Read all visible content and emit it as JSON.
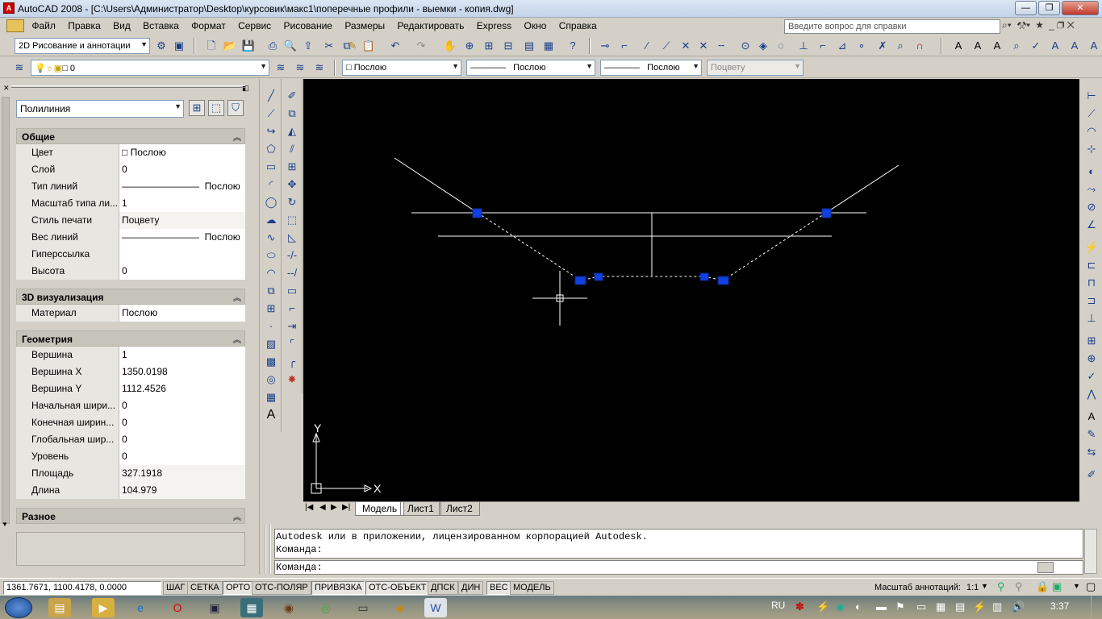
{
  "window": {
    "title": "AutoCAD 2008 - [C:\\Users\\Администратор\\Desktop\\курсовик\\макс1\\поперечные профили - выемки - копия.dwg]",
    "help_placeholder": "Введите вопрос для справки"
  },
  "menu": [
    "Файл",
    "Правка",
    "Вид",
    "Вставка",
    "Формат",
    "Сервис",
    "Рисование",
    "Размеры",
    "Редактировать",
    "Express",
    "Окно",
    "Справка"
  ],
  "toolbar": {
    "workspace": "2D Рисование и аннотации",
    "layer": "0",
    "color": "Послою",
    "linetype": "Послою",
    "lineweight": "Послою",
    "plotstyle": "Поцвету"
  },
  "palette": {
    "object_type": "Полилиния",
    "sections": {
      "general": {
        "title": "Общие",
        "rows": [
          {
            "name": "Цвет",
            "value": "Послою"
          },
          {
            "name": "Слой",
            "value": "0"
          },
          {
            "name": "Тип линий",
            "value": "Послою"
          },
          {
            "name": "Масштаб типа ли...",
            "value": "1"
          },
          {
            "name": "Стиль печати",
            "value": "Поцвету"
          },
          {
            "name": "Вес линий",
            "value": "Послою"
          },
          {
            "name": "Гиперссылка",
            "value": ""
          },
          {
            "name": "Высота",
            "value": "0"
          }
        ]
      },
      "visual3d": {
        "title": "3D визуализация",
        "rows": [
          {
            "name": "Материал",
            "value": "Послою"
          }
        ]
      },
      "geometry": {
        "title": "Геометрия",
        "rows": [
          {
            "name": "Вершина",
            "value": "1"
          },
          {
            "name": "Вершина X",
            "value": "1350.0198"
          },
          {
            "name": "Вершина Y",
            "value": "1112.4526"
          },
          {
            "name": "Начальная шири...",
            "value": "0"
          },
          {
            "name": "Конечная ширин...",
            "value": "0"
          },
          {
            "name": "Глобальная шир...",
            "value": "0"
          },
          {
            "name": "Уровень",
            "value": "0"
          },
          {
            "name": "Площадь",
            "value": "327.1918"
          },
          {
            "name": "Длина",
            "value": "104.979"
          }
        ]
      },
      "misc": {
        "title": "Разное"
      }
    }
  },
  "drawing": {
    "ucs_x": "X",
    "ucs_y": "Y",
    "tabs": [
      "Модель",
      "Лист1",
      "Лист2"
    ]
  },
  "command": {
    "history": [
      "Autodesk или в приложении, лицензированном корпорацией Autodesk.",
      "Команда:"
    ],
    "prompt": "Команда:"
  },
  "status": {
    "coords": "1361.7671, 1100.4178, 0.0000",
    "buttons": [
      "ШАГ",
      "СЕТКА",
      "ОРТО",
      "ОТС-ПОЛЯР",
      "ПРИВЯЗКА",
      "ОТС-ОБЪЕКТ",
      "ДПСК",
      "ДИН",
      "ВЕС",
      "МОДЕЛЬ"
    ],
    "annotation_label": "Масштаб аннотаций:",
    "annotation_scale": "1:1"
  },
  "taskbar": {
    "lang": "RU",
    "time": "3:37"
  }
}
